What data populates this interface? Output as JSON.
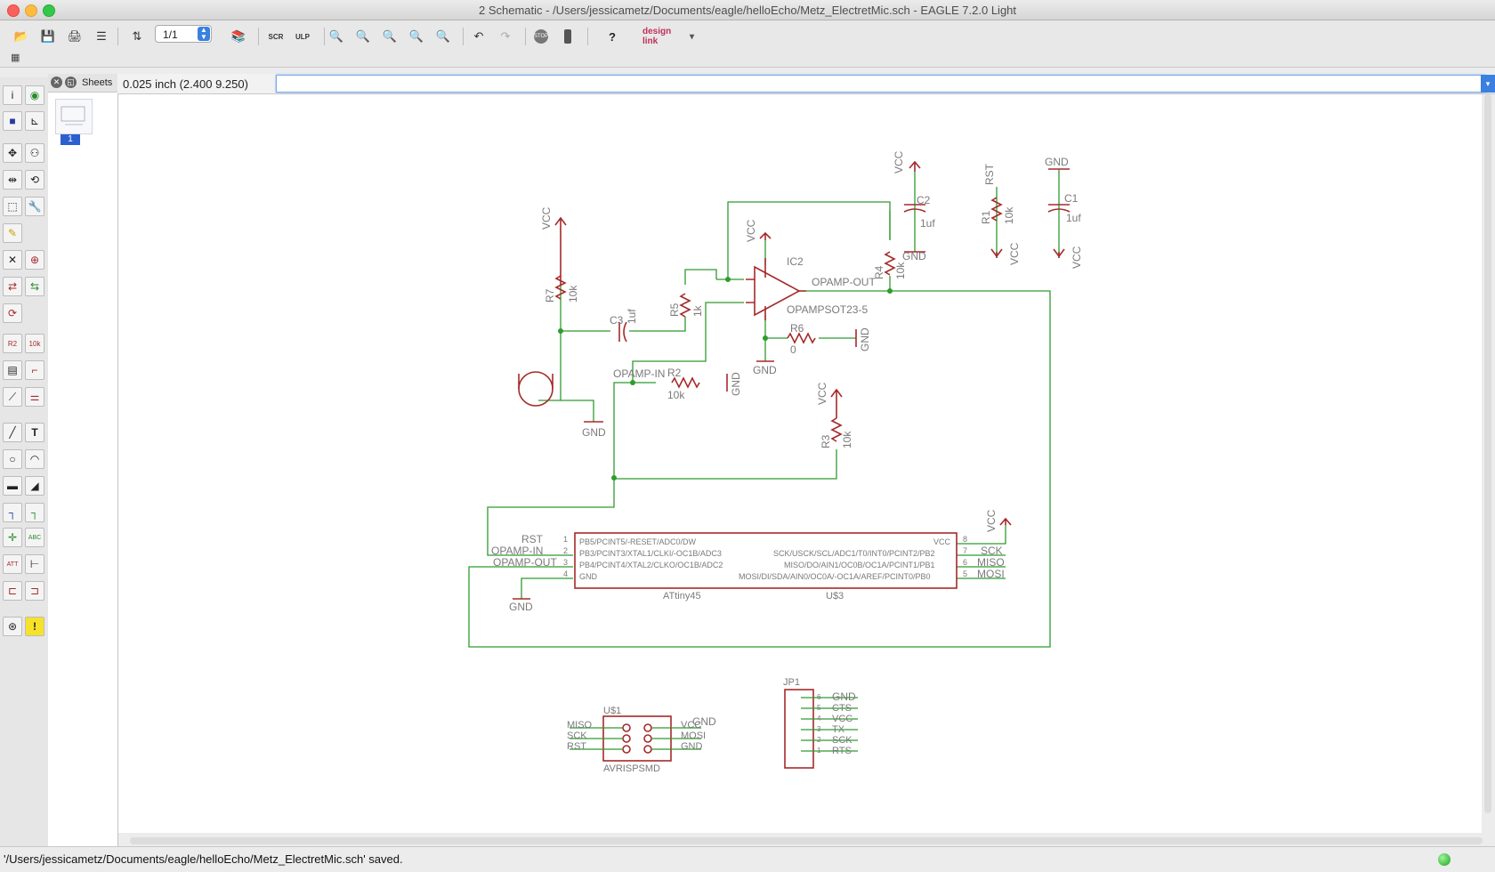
{
  "window": {
    "title": "2 Schematic - /Users/jessicametz/Documents/eagle/helloEcho/Metz_ElectretMic.sch - EAGLE 7.2.0 Light"
  },
  "toolbar": {
    "sheet_value": "1/1",
    "designlink_label": "design link"
  },
  "toolbar_icons": [
    "open-icon",
    "save-icon",
    "print-icon",
    "cam-icon",
    "switch-board-icon",
    "use-library-icon",
    "script-icon",
    "ulp-icon",
    "zoom-fit-icon",
    "zoom-in-icon",
    "zoom-out-icon",
    "zoom-redraw-icon",
    "zoom-select-icon",
    "undo-icon",
    "redo-icon",
    "stop-icon",
    "go-icon",
    "help-icon"
  ],
  "sheets": {
    "label": "Sheets",
    "current": "1"
  },
  "coord": {
    "readout": "0.025 inch (2.400 9.250)",
    "command_value": ""
  },
  "left_tools": [
    "info-icon",
    "show-icon",
    "display-icon",
    "mark-icon",
    "move-icon",
    "copy-icon",
    "mirror-icon",
    "rotate-icon",
    "group-icon",
    "change-icon",
    "paste-icon",
    "delete-icon",
    "add-icon",
    "pinswap-icon",
    "gateswap-icon",
    "replace-icon",
    "name-icon",
    "value-icon",
    "smash-icon",
    "miter-icon",
    "split-icon",
    "invoke-icon",
    "wire-icon",
    "text-icon",
    "circle-icon",
    "arc-icon",
    "rect-icon",
    "polygon-icon",
    "bus-icon",
    "net-icon",
    "junction-icon",
    "label-icon",
    "attribute-icon",
    "dimension-icon",
    "frame-icon",
    "frame2-icon",
    "erc-icon",
    "errors-icon"
  ],
  "schematic": {
    "colors": {
      "part": "#a52a2a",
      "net": "#2f9b2f",
      "text": "#7a7a7a"
    },
    "labels": {
      "vcc": "VCC",
      "gnd": "GND",
      "rst": "RST",
      "r1": "R1",
      "r2": "R2",
      "r3": "R3",
      "r4": "R4",
      "r5": "R5",
      "r6": "R6",
      "r7": "R7",
      "v10k": "10k",
      "v1k": "1k",
      "v0": "0",
      "c1": "C1",
      "c2": "C2",
      "c3": "C3",
      "v1uf": "1uf",
      "ic2": "IC2",
      "opamp_model": "OPAMPSOT23-5",
      "opamp_out": "OPAMP-OUT",
      "opamp_in": "OPAMP-IN",
      "attiny": "ATtiny45",
      "u3": "U$3",
      "u1": "U$1",
      "avr": "AVRISPSMD",
      "jp1": "JP1",
      "miso": "MISO",
      "mosi": "MOSI",
      "sck": "SCK",
      "cts": "CTS",
      "tx": "TX",
      "rts": "RTS",
      "pin_pb5": "PB5/PCINT5/-RESET/ADC0/DW",
      "pin_pb3": "PB3/PCINT3/XTAL1/CLKI/-OC1B/ADC3",
      "pin_pb4": "PB4/PCINT4/XTAL2/CLKO/OC1B/ADC2",
      "pin_gnd": "GND",
      "pin_vcc": "VCC",
      "pin_pb2": "SCK/USCK/SCL/ADC1/T0/INT0/PCINT2/PB2",
      "pin_pb1": "MISO/DO/AIN1/OC0B/OC1A/PCINT1/PB1",
      "pin_pb0": "MOSI/DI/SDA/AIN0/OC0A/-OC1A/AREF/PCINT0/PB0",
      "pins_left": [
        "1",
        "2",
        "3",
        "4"
      ],
      "pins_right": [
        "8",
        "7",
        "6",
        "5"
      ],
      "jp_pins": [
        "6",
        "5",
        "4",
        "3",
        "2",
        "1"
      ],
      "isp_l": [
        "MISO",
        "SCK",
        "RST"
      ],
      "isp_r": [
        "VCC",
        "MOSI",
        "GND"
      ]
    }
  },
  "status": {
    "message": "'/Users/jessicametz/Documents/eagle/helloEcho/Metz_ElectretMic.sch' saved."
  }
}
